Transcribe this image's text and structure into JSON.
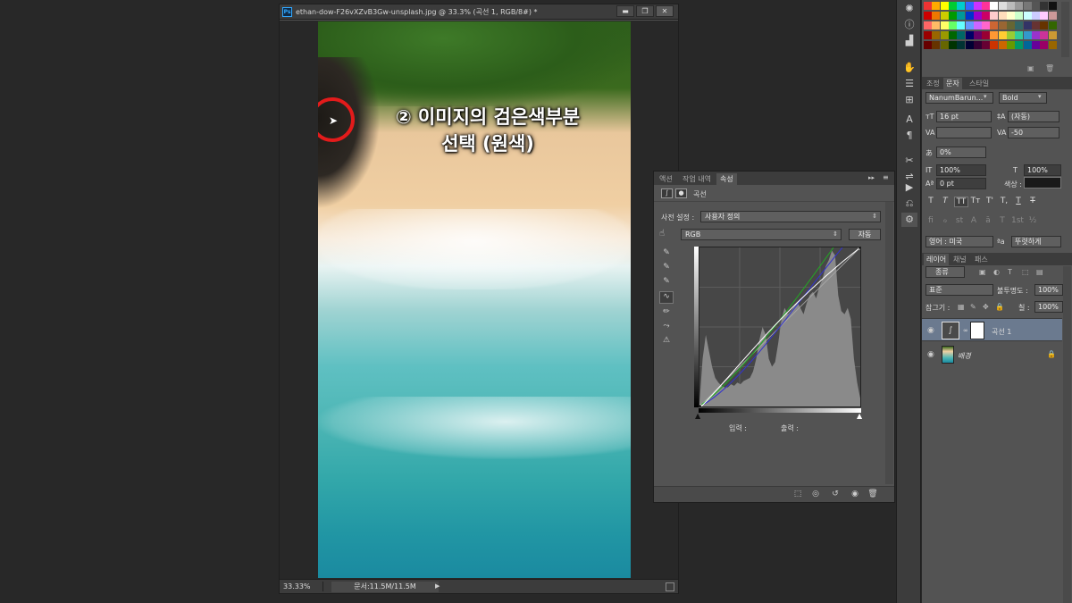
{
  "document": {
    "title": "ethan-dow-F26vXZvB3Gw-unsplash.jpg @ 33.3% (곡선 1, RGB/8#) *",
    "ps_icon": "Ps",
    "window_buttons": [
      "▬",
      "❐",
      "✕"
    ],
    "zoom": "33.33%",
    "doc_info": "문서:11.5M/11.5M",
    "annotation_line1": "② 이미지의 검은색부분",
    "annotation_line2": "선택 (원색)"
  },
  "properties_panel": {
    "tabs": [
      "액션",
      "작업 내역",
      "속성"
    ],
    "active_tab": "속성",
    "header_label": "곡선",
    "preset_label": "사전 설정 :",
    "preset_value": "사용자 정의",
    "channel_value": "RGB",
    "auto_button": "자동",
    "input_label": "입력 :",
    "output_label": "출력 :"
  },
  "character_panel": {
    "tabs": [
      "조정",
      "문자",
      "스타일"
    ],
    "active_tab": "문자",
    "font_family": "NanumBarun...",
    "font_style": "Bold",
    "font_size": "16 pt",
    "leading": "(자동)",
    "kerning": "",
    "tracking": "-50",
    "tsume": "0%",
    "vertical_scale": "100%",
    "horizontal_scale": "100%",
    "baseline_shift": "0 pt",
    "color_label": "색상 :",
    "color_value": "#1a1a1a",
    "glyph_buttons": [
      "T",
      "T",
      "TT",
      "Tт",
      "T'",
      "T,",
      "T",
      "T"
    ],
    "opentype_buttons": [
      "fi",
      "ℴ",
      "st",
      "A",
      "ā",
      "T",
      "1st",
      "½"
    ],
    "language": "영어 : 미국",
    "aa_label": "ªa",
    "antialias": "뚜렷하게"
  },
  "layers_panel": {
    "tabs": [
      "레이어",
      "채널",
      "패스"
    ],
    "active_tab": "레이어",
    "filter_kind": "종류",
    "blend_mode": "표준",
    "opacity_label": "불투명도 :",
    "opacity_value": "100%",
    "lock_label": "잠그기 :",
    "fill_label": "칠 :",
    "fill_value": "100%",
    "layers": [
      {
        "name": "곡선 1",
        "selected": true
      },
      {
        "name": "배경",
        "selected": false
      }
    ]
  },
  "colors": {
    "panel_bg": "#535353",
    "dark_bg": "#282828",
    "annotation_circle": "#e31b1b",
    "selected_layer": "#6b7a8f"
  },
  "chart_data": {
    "type": "area",
    "x": [
      0,
      5,
      10,
      15,
      20,
      25,
      30,
      35,
      40,
      45,
      50,
      55,
      60,
      65,
      70,
      75,
      80,
      85,
      90,
      95,
      100,
      105,
      110,
      115,
      120,
      125,
      130,
      135,
      140,
      145,
      150,
      155,
      160,
      165,
      170,
      175,
      180,
      185,
      190,
      195,
      200,
      205,
      210,
      215,
      220,
      225,
      230,
      235,
      240,
      245,
      250,
      255
    ],
    "values": [
      2,
      30,
      45,
      35,
      25,
      18,
      15,
      13,
      12,
      12,
      14,
      13,
      15,
      14,
      16,
      17,
      18,
      22,
      30,
      42,
      50,
      45,
      30,
      25,
      28,
      40,
      55,
      62,
      58,
      60,
      63,
      66,
      62,
      58,
      65,
      70,
      72,
      68,
      75,
      80,
      88,
      92,
      98,
      95,
      70,
      60,
      58,
      62,
      55,
      30,
      15,
      5
    ],
    "xlim": [
      0,
      255
    ],
    "ylim": [
      0,
      100
    ],
    "title": "",
    "xlabel": "",
    "ylabel": ""
  }
}
